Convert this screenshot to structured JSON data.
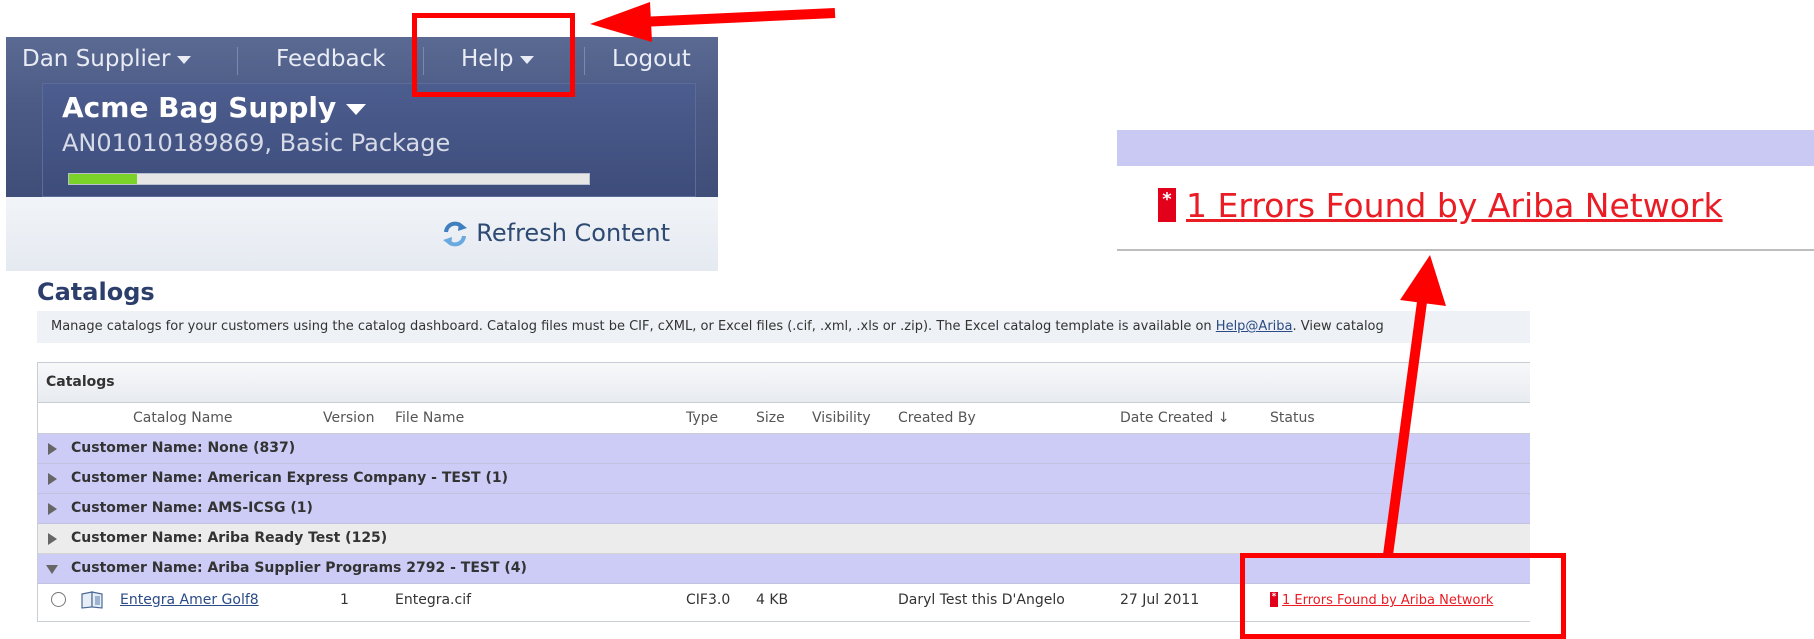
{
  "header": {
    "user_menu": "Dan Supplier",
    "feedback": "Feedback",
    "help": "Help",
    "logout": "Logout",
    "account_name": "Acme Bag Supply",
    "account_id": "AN01010189869, Basic Package",
    "profile_progress": 0.13,
    "refresh_label": "Refresh Content"
  },
  "callout": {
    "error_icon": "error-icon",
    "error_text": "1 Errors Found by Ariba Network"
  },
  "page": {
    "title": "Catalogs",
    "description_before_link": "Manage catalogs for your customers using the catalog dashboard. Catalog files must be CIF, cXML, or Excel files (.cif, .xml, .xls or .zip). The Excel catalog template is available on ",
    "help_link": "Help@Ariba",
    "description_after_link": ". View catalog"
  },
  "catalogs_panel": {
    "title": "Catalogs",
    "columns": {
      "catalog_name": "Catalog Name",
      "version": "Version",
      "file_name": "File Name",
      "type": "Type",
      "size": "Size",
      "visibility": "Visibility",
      "created_by": "Created By",
      "date_created": "Date Created ↓",
      "status": "Status"
    },
    "groups": [
      {
        "label": "Customer Name: None  (837)",
        "expanded": false
      },
      {
        "label": "Customer Name: American Express Company - TEST  (1)",
        "expanded": false
      },
      {
        "label": "Customer Name: AMS-ICSG  (1)",
        "expanded": false
      },
      {
        "label": "Customer Name: Ariba Ready Test  (125)",
        "expanded": false
      },
      {
        "label": "Customer Name: Ariba Supplier Programs 2792 - TEST  (4)",
        "expanded": true
      }
    ],
    "rows": [
      {
        "catalog_name": "Entegra Amer Golf8",
        "version": "1",
        "file_name": "Entegra.cif",
        "type": "CIF3.0",
        "size": "4 KB",
        "visibility": "",
        "created_by": "Daryl Test this D'Angelo",
        "date_created": "27 Jul 2011",
        "status": "1 Errors Found by Ariba Network"
      }
    ]
  },
  "colors": {
    "annotation": "#ff0000",
    "header_bg": "#4b5a84",
    "group_row": "#ccccf6",
    "error_red": "#ea1c24"
  }
}
